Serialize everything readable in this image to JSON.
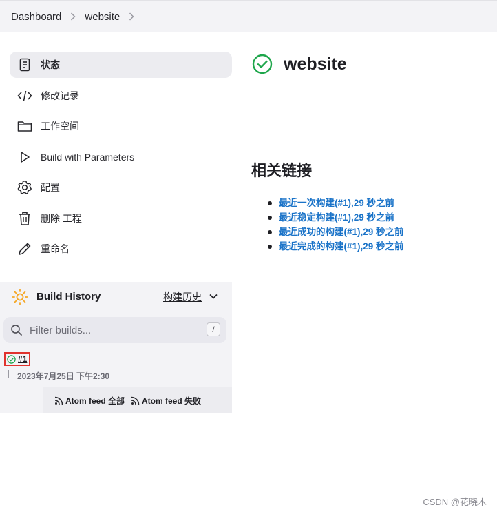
{
  "breadcrumb": {
    "dashboard": "Dashboard",
    "project": "website"
  },
  "sidebar": {
    "items": [
      {
        "label": "状态",
        "icon": "document-icon"
      },
      {
        "label": "修改记录",
        "icon": "code-icon"
      },
      {
        "label": "工作空间",
        "icon": "folder-icon"
      },
      {
        "label": "Build with Parameters",
        "icon": "play-icon"
      },
      {
        "label": "配置",
        "icon": "gear-icon"
      },
      {
        "label": "删除 工程",
        "icon": "trash-icon"
      },
      {
        "label": "重命名",
        "icon": "pencil-icon"
      }
    ]
  },
  "build_history": {
    "title": "Build History",
    "trend_label": "构建历史",
    "filter_placeholder": "Filter builds...",
    "shortcut_key": "/",
    "builds": [
      {
        "number": "#1",
        "time": "2023年7月25日 下午2:30",
        "status": "success"
      }
    ],
    "feeds": {
      "all": "Atom feed 全部",
      "failed": "Atom feed 失败"
    }
  },
  "main": {
    "title": "website",
    "related_heading": "相关链接",
    "links": [
      "最近一次构建(#1),29 秒之前",
      "最近稳定构建(#1),29 秒之前",
      "最近成功的构建(#1),29 秒之前",
      "最近完成的构建(#1),29 秒之前"
    ]
  },
  "watermark": "CSDN @花晓木",
  "colors": {
    "success": "#1ea64b",
    "link": "#1a73c8",
    "highlight_border": "#e0332e",
    "sun": "#f5a623"
  }
}
